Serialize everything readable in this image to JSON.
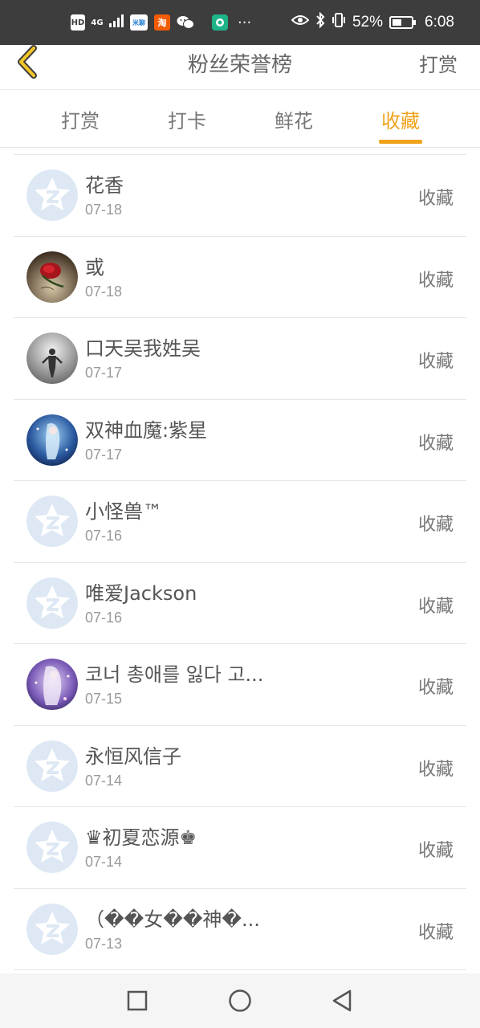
{
  "status_bar": {
    "hd": "HD",
    "network": "4G",
    "app1": "米聊",
    "app2": "淘",
    "battery_text": "52%",
    "battery_level": 0.52,
    "time": "6:08",
    "more": "···"
  },
  "header": {
    "title": "粉丝荣誉榜",
    "action": "打赏"
  },
  "tabs": [
    "打赏",
    "打卡",
    "鲜花",
    "收藏"
  ],
  "active_tab": 3,
  "list": [
    {
      "name": "花香",
      "date": "07-18",
      "action": "收藏",
      "avatar": "default"
    },
    {
      "name": "或",
      "date": "07-18",
      "action": "收藏",
      "avatar": "rose"
    },
    {
      "name": "口天吴我姓吴",
      "date": "07-17",
      "action": "收藏",
      "avatar": "gray-figure"
    },
    {
      "name": "双神血魔:紫星",
      "date": "07-17",
      "action": "收藏",
      "avatar": "blue-anime"
    },
    {
      "name": "小怪兽™",
      "date": "07-16",
      "action": "收藏",
      "avatar": "default"
    },
    {
      "name": "唯爱Jackson",
      "date": "07-16",
      "action": "收藏",
      "avatar": "default"
    },
    {
      "name": "코너 총애를 잃다 고...",
      "date": "07-15",
      "action": "收藏",
      "avatar": "purple-anime"
    },
    {
      "name": "永恒风信子",
      "date": "07-14",
      "action": "收藏",
      "avatar": "default"
    },
    {
      "name": "♛初夏恋源♚",
      "date": "07-14",
      "action": "收藏",
      "avatar": "default"
    },
    {
      "name": "（��女��神�...",
      "date": "07-13",
      "action": "收藏",
      "avatar": "default"
    }
  ],
  "colors": {
    "accent": "#f0a31a",
    "status_bar": "#3d3d3d",
    "default_avatar": "#dde8f4"
  }
}
